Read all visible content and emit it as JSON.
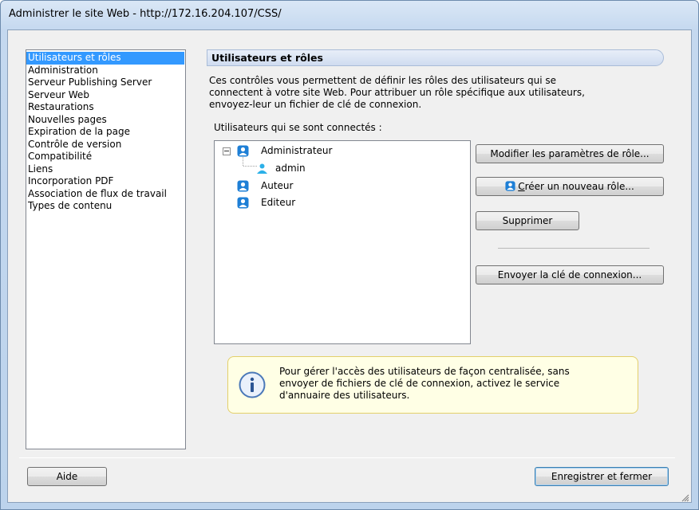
{
  "window": {
    "title": "Administrer le site Web - http://172.16.204.107/CSS/"
  },
  "nav": {
    "items": [
      {
        "label": "Utilisateurs et rôles",
        "selected": true
      },
      {
        "label": "Administration"
      },
      {
        "label": "Serveur Publishing Server"
      },
      {
        "label": "Serveur Web"
      },
      {
        "label": "Restaurations"
      },
      {
        "label": "Nouvelles pages"
      },
      {
        "label": "Expiration de la page"
      },
      {
        "label": "Contrôle de version"
      },
      {
        "label": "Compatibilité"
      },
      {
        "label": "Liens"
      },
      {
        "label": "Incorporation PDF"
      },
      {
        "label": "Association de flux de travail"
      },
      {
        "label": "Types de contenu"
      }
    ]
  },
  "section": {
    "title": "Utilisateurs et rôles",
    "description_lines": [
      "Ces contrôles vous permettent de définir les rôles des utilisateurs qui se",
      "connectent à votre site Web. Pour attribuer un rôle spécifique aux utilisateurs,",
      "envoyez-leur un fichier de clé de connexion."
    ],
    "users_label": "Utilisateurs qui se sont connectés :"
  },
  "tree": {
    "nodes": [
      {
        "label": "Administrateur",
        "expanded": true,
        "icon": "role-icon"
      },
      {
        "label": "admin",
        "child": true,
        "icon": "user-icon"
      },
      {
        "label": "Auteur",
        "icon": "role-icon"
      },
      {
        "label": "Editeur",
        "icon": "role-icon"
      }
    ]
  },
  "buttons": {
    "modify_role": "Modifier les paramètres de rôle...",
    "create_role_accel": "C",
    "create_role_rest": "réer un nouveau rôle...",
    "delete": "Supprimer",
    "send_key": "Envoyer la clé de connexion...",
    "help": "Aide",
    "save_close": "Enregistrer et fermer"
  },
  "info": {
    "lines": [
      "Pour gérer l'accès des utilisateurs de façon centralisée, sans",
      "envoyer de fichiers de clé de connexion, activez le service",
      "d'annuaire des utilisateurs."
    ]
  },
  "colors": {
    "selection": "#3399ff",
    "role_icon": "#1e7fd6",
    "user_icon": "#2bb0e8"
  }
}
